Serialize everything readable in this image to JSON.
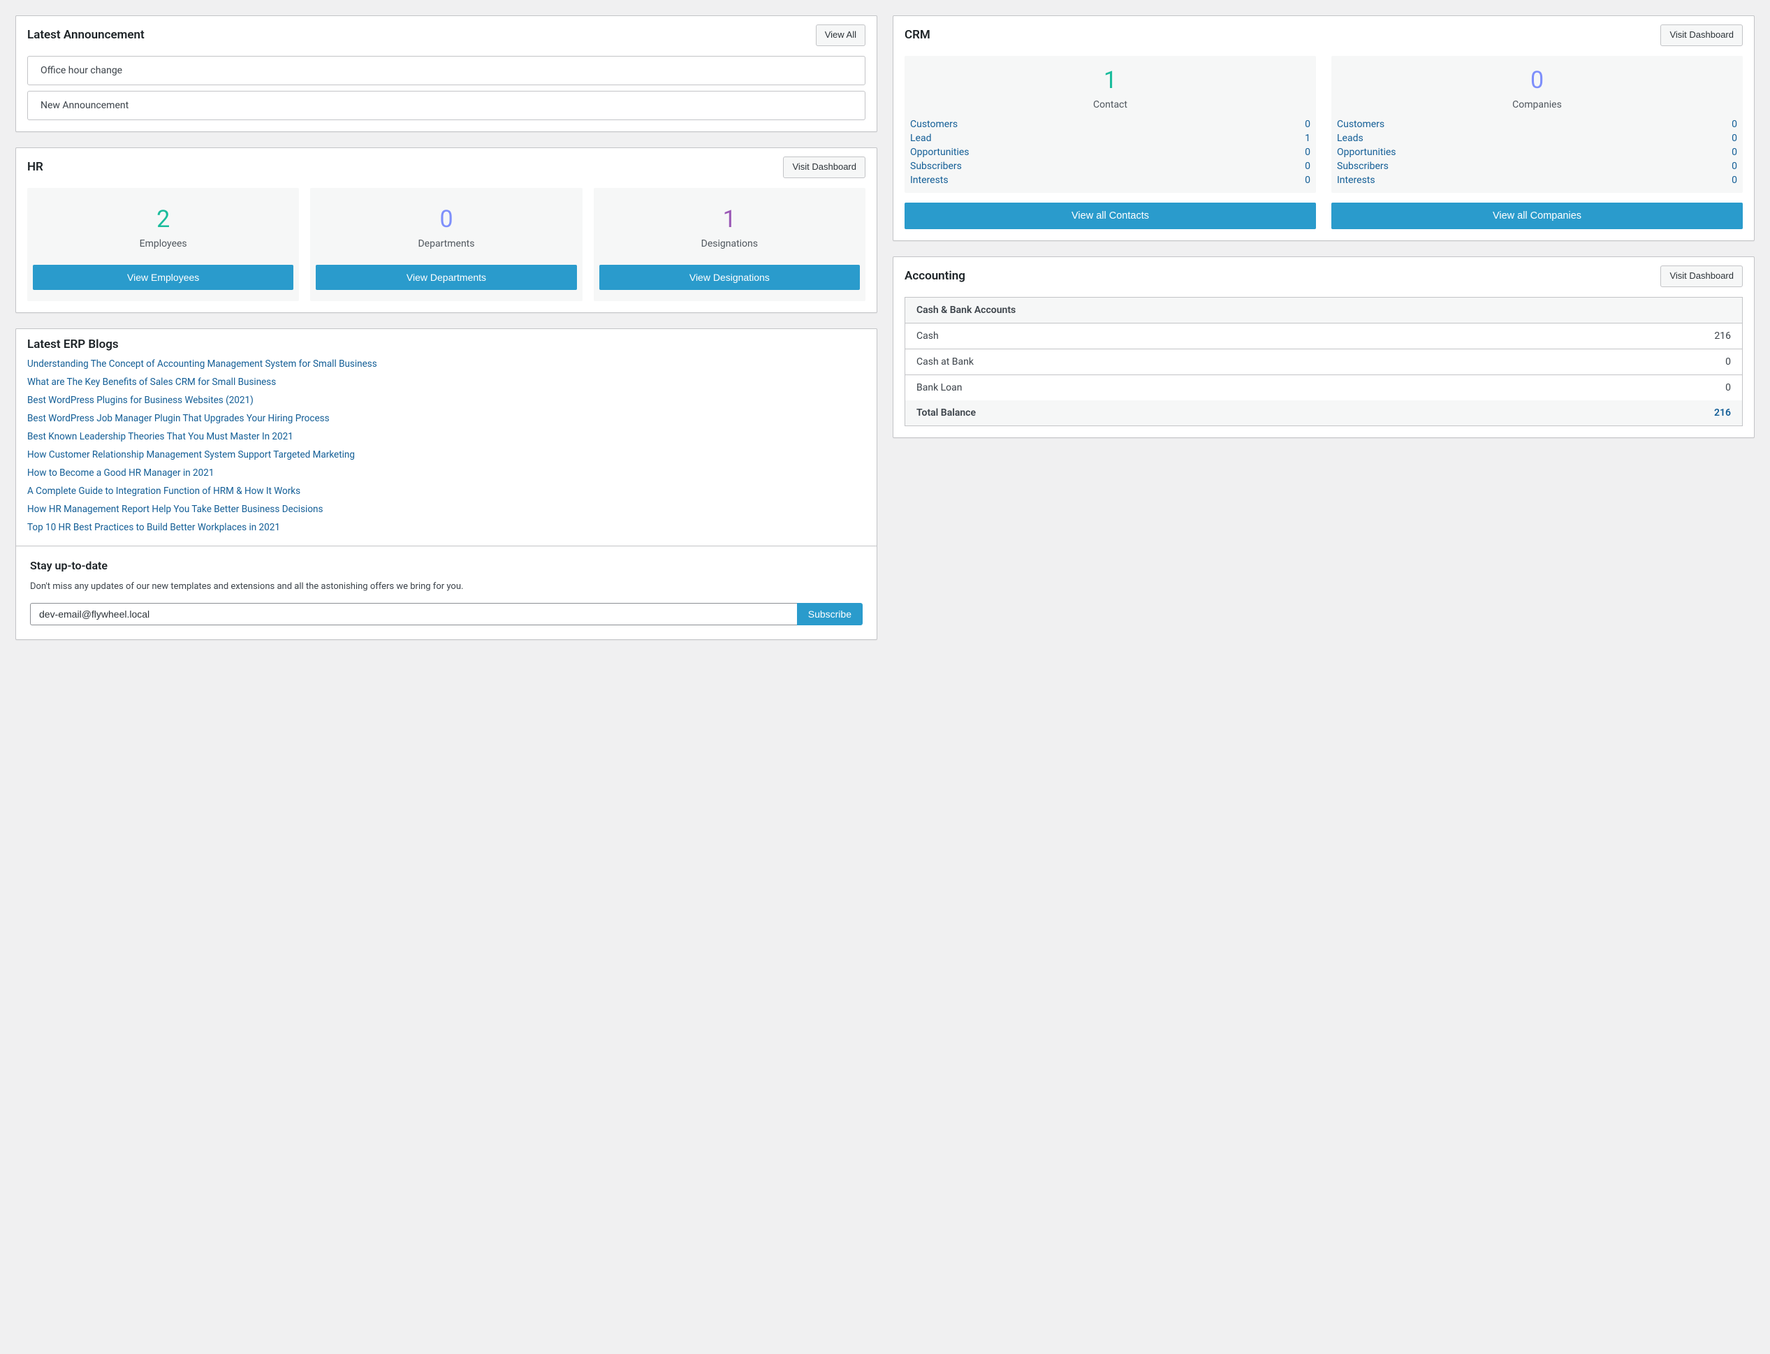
{
  "announcements": {
    "title": "Latest Announcement",
    "viewAll": "View All",
    "items": [
      "Office hour change",
      "New Announcement"
    ]
  },
  "hr": {
    "title": "HR",
    "visit": "Visit Dashboard",
    "stats": [
      {
        "value": "2",
        "label": "Employees",
        "btn": "View Employees",
        "color": "c-green"
      },
      {
        "value": "0",
        "label": "Departments",
        "btn": "View Departments",
        "color": "c-violet"
      },
      {
        "value": "1",
        "label": "Designations",
        "btn": "View Designations",
        "color": "c-purple"
      }
    ]
  },
  "blogs": {
    "title": "Latest ERP Blogs",
    "items": [
      "Understanding The Concept of Accounting Management System for Small Business",
      "What are The Key Benefits of Sales CRM for Small Business",
      "Best WordPress Plugins for Business Websites (2021)",
      "Best WordPress Job Manager Plugin That Upgrades Your Hiring Process",
      "Best Known Leadership Theories That You Must Master In 2021",
      "How Customer Relationship Management System Support Targeted Marketing",
      "How to Become a Good HR Manager in 2021",
      "A Complete Guide to Integration Function of HRM & How It Works",
      "How HR Management Report Help You Take Better Business Decisions",
      "Top 10 HR Best Practices to Build Better Workplaces in 2021"
    ]
  },
  "subscribe": {
    "title": "Stay up-to-date",
    "note": "Don't miss any updates of our new templates and extensions and all the astonishing offers we bring for you.",
    "email": "dev-email@flywheel.local",
    "btn": "Subscribe"
  },
  "crm": {
    "title": "CRM",
    "visit": "Visit Dashboard",
    "panels": [
      {
        "num": "1",
        "sub": "Contact",
        "color": "c-green",
        "rows": [
          {
            "label": "Customers",
            "val": "0"
          },
          {
            "label": "Lead",
            "val": "1"
          },
          {
            "label": "Opportunities",
            "val": "0"
          },
          {
            "label": "Subscribers",
            "val": "0"
          },
          {
            "label": "Interests",
            "val": "0"
          }
        ],
        "btn": "View all Contacts"
      },
      {
        "num": "0",
        "sub": "Companies",
        "color": "c-violet",
        "rows": [
          {
            "label": "Customers",
            "val": "0"
          },
          {
            "label": "Leads",
            "val": "0"
          },
          {
            "label": "Opportunities",
            "val": "0"
          },
          {
            "label": "Subscribers",
            "val": "0"
          },
          {
            "label": "Interests",
            "val": "0"
          }
        ],
        "btn": "View all Companies"
      }
    ]
  },
  "accounting": {
    "title": "Accounting",
    "visit": "Visit Dashboard",
    "header": "Cash & Bank Accounts",
    "rows": [
      {
        "label": "Cash",
        "val": "216"
      },
      {
        "label": "Cash at Bank",
        "val": "0"
      },
      {
        "label": "Bank Loan",
        "val": "0"
      }
    ],
    "totalLabel": "Total Balance",
    "totalVal": "216"
  }
}
